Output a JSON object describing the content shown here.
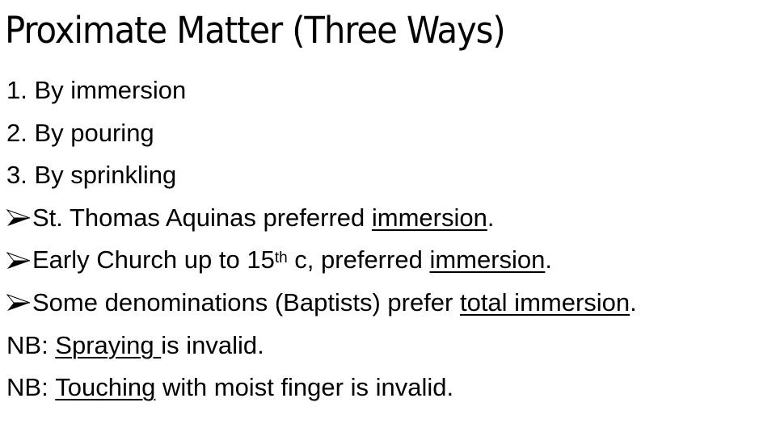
{
  "title": "Proximate Matter (Three Ways)",
  "numbered_items": [
    "1. By immersion",
    "2. By pouring",
    "3. By sprinkling"
  ],
  "bullets": [
    {
      "icon": "arrow-bullet-icon",
      "before": "St. Thomas Aquinas preferred ",
      "underlined": "immersion",
      "after": "."
    },
    {
      "icon": "arrow-bullet-icon",
      "before": "Early Church up to 15",
      "superscript": "th",
      "mid": " c, preferred ",
      "underlined": "immersion",
      "after": "."
    },
    {
      "icon": "arrow-bullet-icon",
      "before": "Some denominations (Baptists) prefer ",
      "underlined": "total immersion",
      "after": "."
    }
  ],
  "notes": [
    {
      "prefix": "NB: ",
      "underlined": "Spraying ",
      "after": "is invalid."
    },
    {
      "prefix": "NB: ",
      "underlined": "Touching",
      "after": " with moist finger is invalid."
    }
  ]
}
